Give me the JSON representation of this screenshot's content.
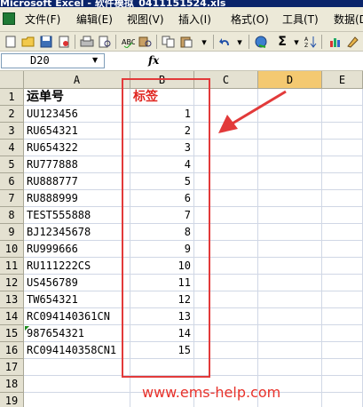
{
  "window": {
    "title": "Microsoft Excel - 软件模拟_0411151524.xls"
  },
  "menu": {
    "items": [
      "文件(F)",
      "编辑(E)",
      "视图(V)",
      "插入(I)",
      "格式(O)",
      "工具(T)",
      "数据(D)"
    ]
  },
  "toolbar": {
    "icons": [
      "new-icon",
      "open-icon",
      "save-icon",
      "permission-icon",
      "print-icon",
      "print-preview-icon",
      "spellcheck-icon",
      "research-icon",
      "copy-icon",
      "paste-icon",
      "undo-icon",
      "hyperlink-icon",
      "autosum-icon",
      "sort-icon",
      "chart-icon",
      "drawing-icon"
    ],
    "sigma": "Σ"
  },
  "formula_bar": {
    "name_box": "D20",
    "fx": "fx",
    "value": ""
  },
  "sheet": {
    "columns": [
      "A",
      "B",
      "C",
      "D",
      "E"
    ],
    "selected_column": "D",
    "rows": [
      "1",
      "2",
      "3",
      "4",
      "5",
      "6",
      "7",
      "8",
      "9",
      "10",
      "11",
      "12",
      "13",
      "14",
      "15",
      "16",
      "17",
      "18",
      "19"
    ],
    "header": {
      "a": "运单号",
      "b": "标签"
    },
    "data": [
      {
        "a": "UU123456",
        "b": "1"
      },
      {
        "a": "RU654321",
        "b": "2"
      },
      {
        "a": "RU654322",
        "b": "3"
      },
      {
        "a": "RU777888",
        "b": "4"
      },
      {
        "a": "RU888777",
        "b": "5"
      },
      {
        "a": "RU888999",
        "b": "6"
      },
      {
        "a": "TEST555888",
        "b": "7"
      },
      {
        "a": "BJ12345678",
        "b": "8"
      },
      {
        "a": "RU999666",
        "b": "9"
      },
      {
        "a": "RU111222CS",
        "b": "10"
      },
      {
        "a": "US456789",
        "b": "11"
      },
      {
        "a": "TW654321",
        "b": "12"
      },
      {
        "a": "RC094140361CN",
        "b": "13"
      },
      {
        "a": "987654321",
        "b": "14"
      },
      {
        "a": "RC094140358CN1",
        "b": "15"
      }
    ]
  },
  "annotation": {
    "frame_color": "#e23a3a",
    "arrow_color": "#e23a3a",
    "watermark": "www.ems-help.com"
  },
  "colors": {
    "header_red": "#e0251f",
    "selected_column": "#f4c971",
    "title_bar": "#0a246a"
  }
}
